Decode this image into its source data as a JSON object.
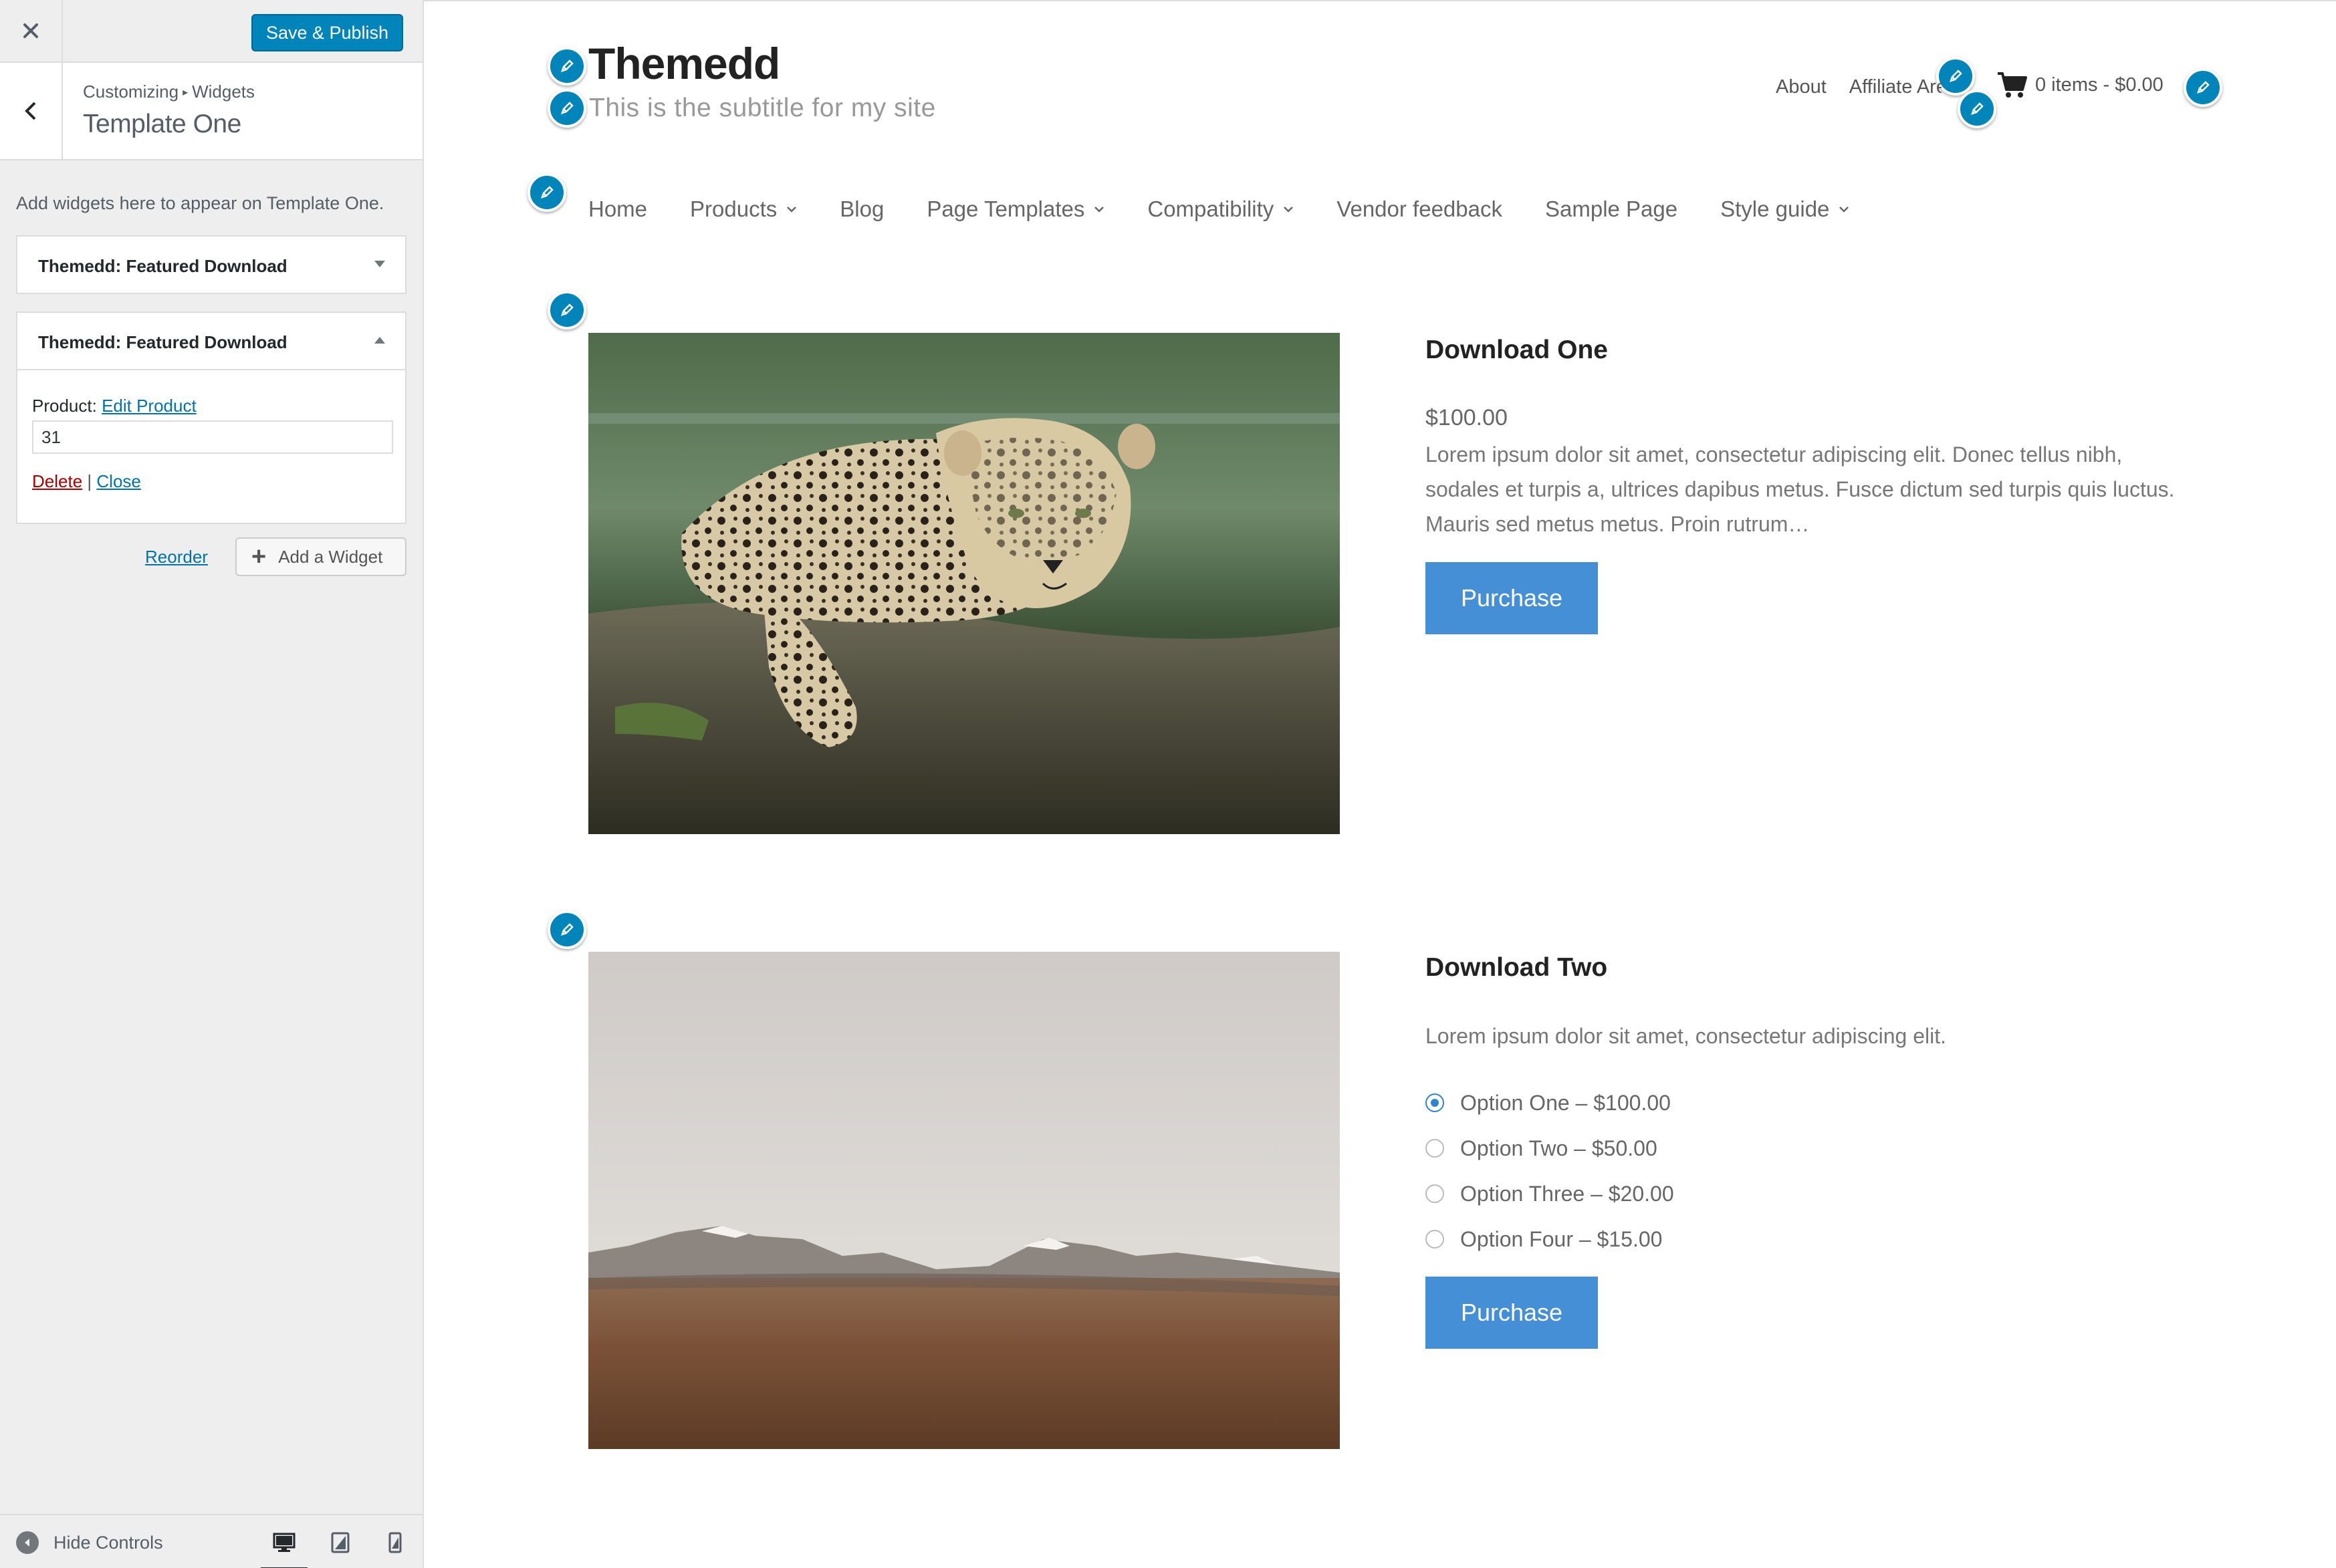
{
  "customizer": {
    "save_label": "Save & Publish",
    "breadcrumb_root": "Customizing",
    "breadcrumb_sep": "▸",
    "breadcrumb_parent": "Widgets",
    "section_title": "Template One",
    "description": "Add widgets here to appear on Template One.",
    "widgets": [
      {
        "title": "Themedd: Featured Download",
        "expanded": false
      },
      {
        "title": "Themedd: Featured Download",
        "expanded": true
      }
    ],
    "widget_form": {
      "product_label": "Product:",
      "edit_product_link": "Edit Product",
      "product_value": "31",
      "delete_label": "Delete",
      "separator": "|",
      "close_label": "Close"
    },
    "reorder_label": "Reorder",
    "add_widget_label": "Add a Widget",
    "hide_controls_label": "Hide Controls",
    "devices": [
      "desktop",
      "tablet",
      "mobile"
    ],
    "accent_color": "#0085ba"
  },
  "site": {
    "title": "Themedd",
    "subtitle": "This is the subtitle for my site",
    "secondary_menu": [
      "About",
      "Affiliate Area"
    ],
    "cart_text": "0 items - $0.00",
    "primary_menu": [
      {
        "label": "Home",
        "has_children": false
      },
      {
        "label": "Products",
        "has_children": true
      },
      {
        "label": "Blog",
        "has_children": false
      },
      {
        "label": "Page Templates",
        "has_children": true
      },
      {
        "label": "Compatibility",
        "has_children": true
      },
      {
        "label": "Vendor feedback",
        "has_children": false
      },
      {
        "label": "Sample Page",
        "has_children": false
      },
      {
        "label": "Style guide",
        "has_children": true
      }
    ]
  },
  "downloads": [
    {
      "title": "Download One",
      "price": "$100.00",
      "description": "Lorem ipsum dolor sit amet, consectetur adipiscing elit. Donec tellus nibh, sodales et turpis a, ultrices dapibus metus. Fusce dictum sed turpis quis luctus. Mauris sed metus metus. Proin rutrum…",
      "purchase_label": "Purchase",
      "image": "leopard-on-log"
    },
    {
      "title": "Download Two",
      "description": "Lorem ipsum dolor sit amet, consectetur adipiscing elit.",
      "options": [
        {
          "label": "Option One – $100.00",
          "selected": true
        },
        {
          "label": "Option Two – $50.00",
          "selected": false
        },
        {
          "label": "Option Three – $20.00",
          "selected": false
        },
        {
          "label": "Option Four – $15.00",
          "selected": false
        }
      ],
      "purchase_label": "Purchase",
      "image": "desert-mountains"
    }
  ],
  "colors": {
    "purchase_button": "#448fd5",
    "edit_shortcut": "#0085ba",
    "link": "#0073aa",
    "delete": "#aa0000"
  }
}
